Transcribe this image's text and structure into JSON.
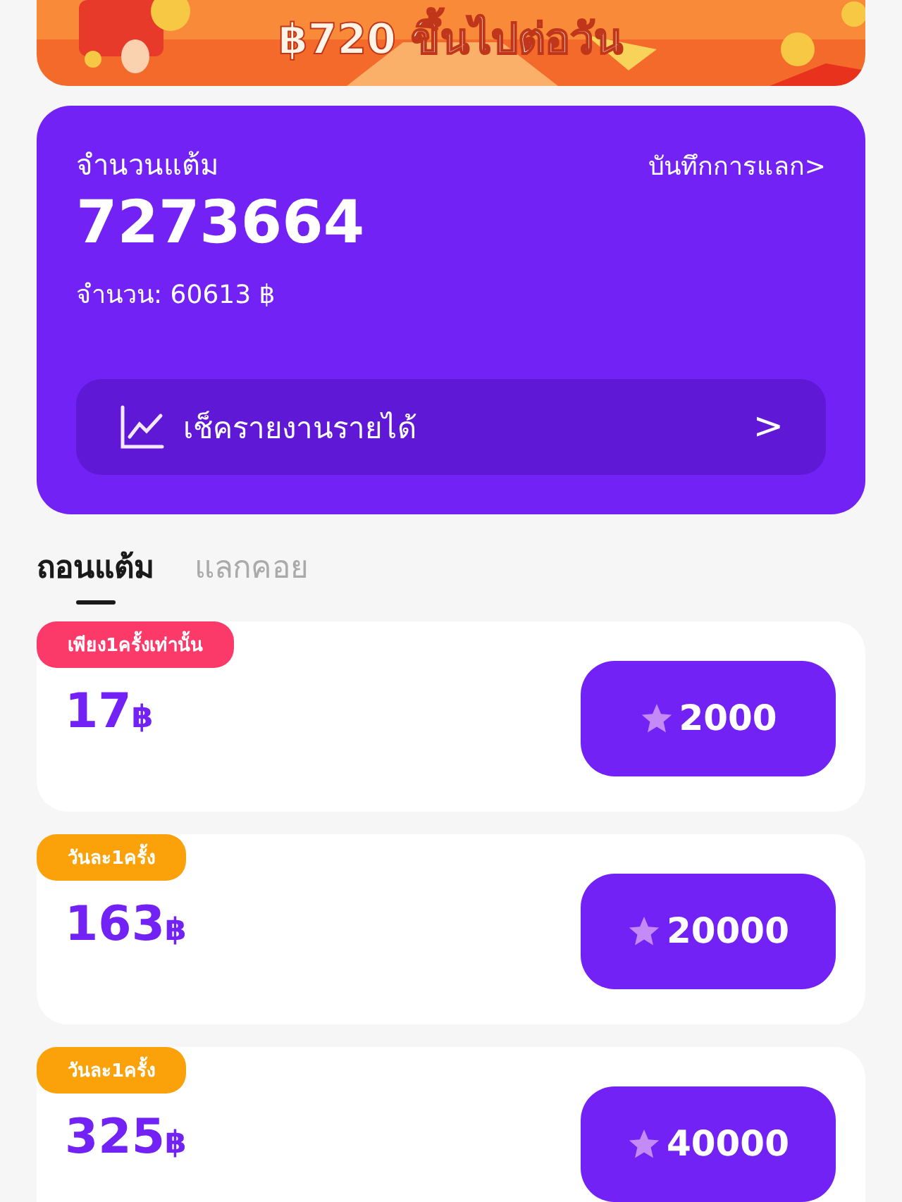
{
  "banner": {
    "text": "฿720 ขึ้นไปต่อวัน"
  },
  "points_card": {
    "label": "จำนวนแต้ม",
    "history_link": "บันทึกการแลก>",
    "points": "7273664",
    "amount": "จำนวน: 60613 ฿",
    "report_button": "เช็ครายงานรายได้",
    "report_arrow": ">"
  },
  "tabs": [
    {
      "label": "ถอนแต้ม",
      "selected": true
    },
    {
      "label": "แลกคอย",
      "selected": false
    }
  ],
  "rewards": [
    {
      "tag": "เพียง1ครั้งเท่านั้น",
      "color": "#fb3a6a",
      "amount": "17",
      "currency": "฿",
      "price": "2000"
    },
    {
      "tag": "วันละ1ครั้ง",
      "color": "#fba10a",
      "amount": "163",
      "currency": "฿",
      "price": "20000"
    },
    {
      "tag": "วันละ1ครั้ง",
      "color": "#fba10a",
      "amount": "325",
      "currency": "฿",
      "price": "40000"
    }
  ]
}
